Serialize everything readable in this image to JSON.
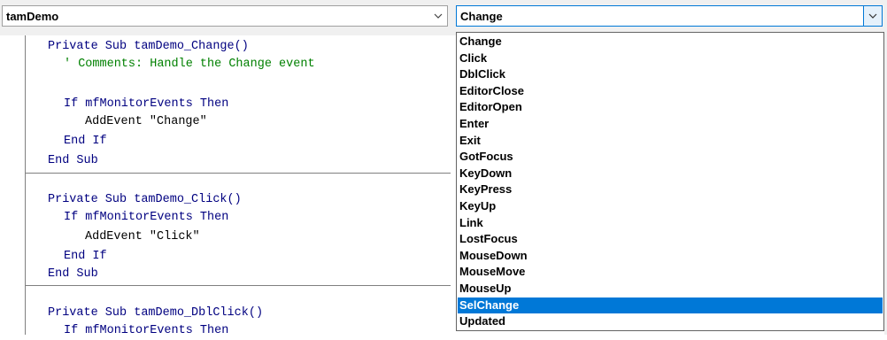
{
  "object_combo": {
    "value": "tamDemo"
  },
  "procedure_combo": {
    "value": "Change"
  },
  "code": {
    "block1": {
      "l1": "Private Sub tamDemo_Change()",
      "l2": "' Comments: Handle the Change event",
      "l3": "If mfMonitorEvents Then",
      "l4": "AddEvent \"Change\"",
      "l5": "End If",
      "l6": "End Sub"
    },
    "block2": {
      "l1": "Private Sub tamDemo_Click()",
      "l2": "If mfMonitorEvents Then",
      "l3": "AddEvent \"Click\"",
      "l4": "End If",
      "l5": "End Sub"
    },
    "block3": {
      "l1": "Private Sub tamDemo_DblClick()",
      "l2": "If mfMonitorEvents Then"
    }
  },
  "dropdown": {
    "items": [
      "Change",
      "Click",
      "DblClick",
      "EditorClose",
      "EditorOpen",
      "Enter",
      "Exit",
      "GotFocus",
      "KeyDown",
      "KeyPress",
      "KeyUp",
      "Link",
      "LostFocus",
      "MouseDown",
      "MouseMove",
      "MouseUp",
      "SelChange",
      "Updated"
    ],
    "selected": "SelChange"
  },
  "colors": {
    "keyword": "#000080",
    "comment": "#008000",
    "selection": "#0078d7"
  },
  "icons": {
    "combo_arrow": "chevron-down-icon"
  }
}
